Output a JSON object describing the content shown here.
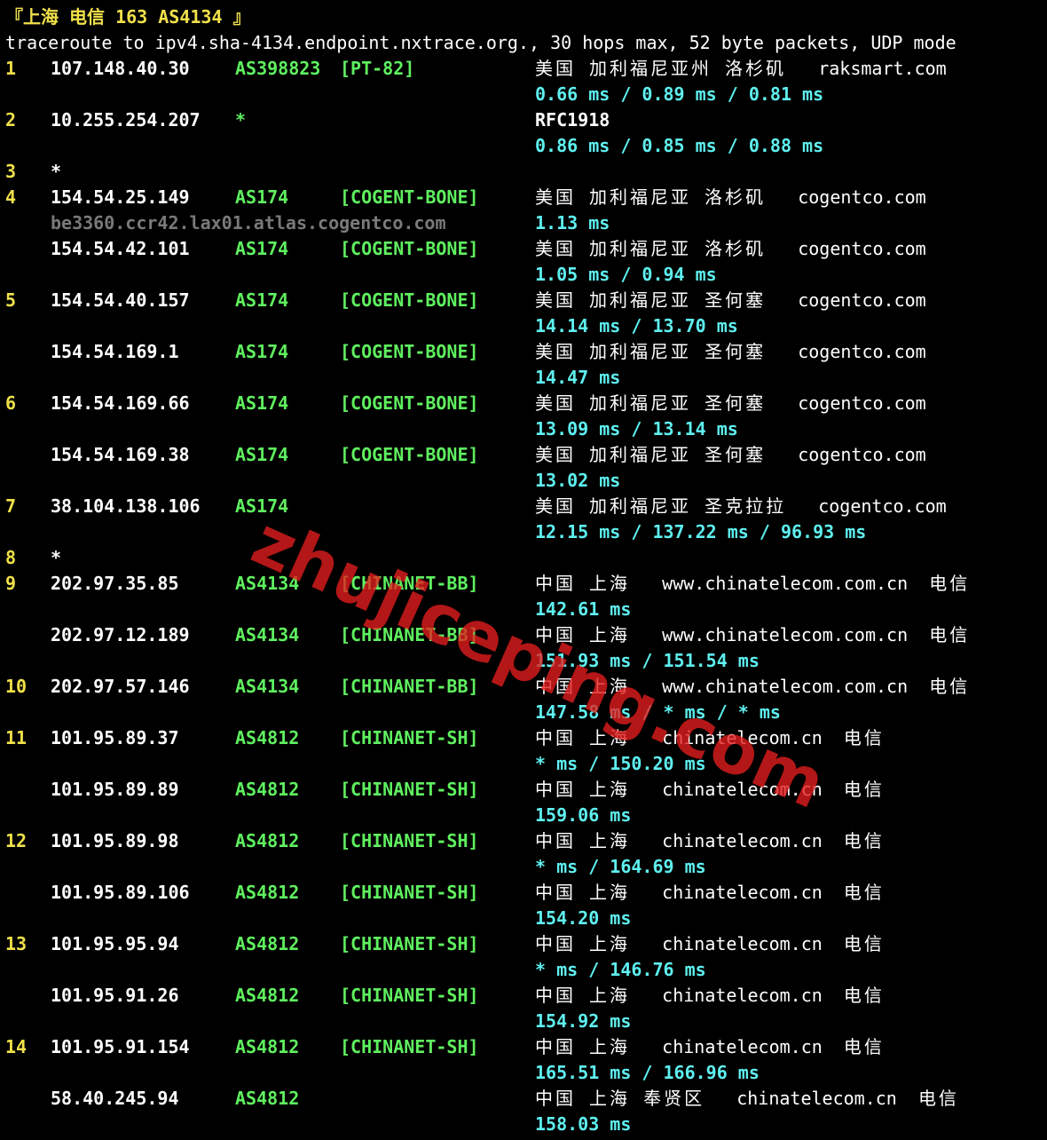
{
  "colors": {
    "background": "#000000",
    "hop_number": "#f0e14a",
    "asn": "#5ff05f",
    "latency": "#5ff0f0",
    "hostname": "#7a7a7a",
    "watermark": "#e61e1e"
  },
  "header": {
    "title": "『上海 电信 163 AS4134 』",
    "command": "traceroute to ipv4.sha-4134.endpoint.nxtrace.org., 30 hops max, 52 byte packets, UDP mode"
  },
  "watermark": "zhujiceping.com",
  "rows": [
    {
      "hop": "1",
      "ip": "107.148.40.30",
      "asn": "AS398823",
      "tag": "[PT-82]",
      "geo": "美国 加利福尼亚州 洛杉矶",
      "domain": "raksmart.com",
      "isp": ""
    },
    {
      "latency": "0.66 ms / 0.89 ms / 0.81 ms"
    },
    {
      "hop": "2",
      "ip": "10.255.254.207",
      "asn": "*",
      "tag": "",
      "geo": "RFC1918",
      "domain": "",
      "isp": ""
    },
    {
      "latency": "0.86 ms / 0.85 ms / 0.88 ms"
    },
    {
      "hop": "3",
      "ip": "*"
    },
    {
      "hop": "4",
      "ip": "154.54.25.149",
      "asn": "AS174",
      "tag": "[COGENT-BONE]",
      "geo": "美国 加利福尼亚 洛杉矶",
      "domain": "cogentco.com",
      "isp": ""
    },
    {
      "hostname": "be3360.ccr42.lax01.atlas.cogentco.com",
      "latency": "1.13 ms"
    },
    {
      "ip": "154.54.42.101",
      "asn": "AS174",
      "tag": "[COGENT-BONE]",
      "geo": "美国 加利福尼亚 洛杉矶",
      "domain": "cogentco.com",
      "isp": ""
    },
    {
      "latency": "1.05 ms / 0.94 ms"
    },
    {
      "hop": "5",
      "ip": "154.54.40.157",
      "asn": "AS174",
      "tag": "[COGENT-BONE]",
      "geo": "美国 加利福尼亚 圣何塞",
      "domain": "cogentco.com",
      "isp": ""
    },
    {
      "latency": "14.14 ms / 13.70 ms"
    },
    {
      "ip": "154.54.169.1",
      "asn": "AS174",
      "tag": "[COGENT-BONE]",
      "geo": "美国 加利福尼亚 圣何塞",
      "domain": "cogentco.com",
      "isp": ""
    },
    {
      "latency": "14.47 ms"
    },
    {
      "hop": "6",
      "ip": "154.54.169.66",
      "asn": "AS174",
      "tag": "[COGENT-BONE]",
      "geo": "美国 加利福尼亚 圣何塞",
      "domain": "cogentco.com",
      "isp": ""
    },
    {
      "latency": "13.09 ms / 13.14 ms"
    },
    {
      "ip": "154.54.169.38",
      "asn": "AS174",
      "tag": "[COGENT-BONE]",
      "geo": "美国 加利福尼亚 圣何塞",
      "domain": "cogentco.com",
      "isp": ""
    },
    {
      "latency": "13.02 ms"
    },
    {
      "hop": "7",
      "ip": "38.104.138.106",
      "asn": "AS174",
      "tag": "",
      "geo": "美国 加利福尼亚 圣克拉拉",
      "domain": "cogentco.com",
      "isp": ""
    },
    {
      "latency": "12.15 ms / 137.22 ms / 96.93 ms"
    },
    {
      "hop": "8",
      "ip": "*"
    },
    {
      "hop": "9",
      "ip": "202.97.35.85",
      "asn": "AS4134",
      "tag": "[CHINANET-BB]",
      "geo": "中国 上海",
      "domain": "www.chinatelecom.com.cn",
      "isp": "电信"
    },
    {
      "latency": "142.61 ms"
    },
    {
      "ip": "202.97.12.189",
      "asn": "AS4134",
      "tag": "[CHINANET-BB]",
      "geo": "中国 上海",
      "domain": "www.chinatelecom.com.cn",
      "isp": "电信"
    },
    {
      "latency": "151.93 ms / 151.54 ms"
    },
    {
      "hop": "10",
      "ip": "202.97.57.146",
      "asn": "AS4134",
      "tag": "[CHINANET-BB]",
      "geo": "中国 上海",
      "domain": "www.chinatelecom.com.cn",
      "isp": "电信"
    },
    {
      "latency": "147.58 ms / * ms / * ms"
    },
    {
      "hop": "11",
      "ip": "101.95.89.37",
      "asn": "AS4812",
      "tag": "[CHINANET-SH]",
      "geo": "中国 上海",
      "domain": "chinatelecom.cn",
      "isp": "电信"
    },
    {
      "latency": "* ms / 150.20 ms"
    },
    {
      "ip": "101.95.89.89",
      "asn": "AS4812",
      "tag": "[CHINANET-SH]",
      "geo": "中国 上海",
      "domain": "chinatelecom.cn",
      "isp": "电信"
    },
    {
      "latency": "159.06 ms"
    },
    {
      "hop": "12",
      "ip": "101.95.89.98",
      "asn": "AS4812",
      "tag": "[CHINANET-SH]",
      "geo": "中国 上海",
      "domain": "chinatelecom.cn",
      "isp": "电信"
    },
    {
      "latency": "* ms / 164.69 ms"
    },
    {
      "ip": "101.95.89.106",
      "asn": "AS4812",
      "tag": "[CHINANET-SH]",
      "geo": "中国 上海",
      "domain": "chinatelecom.cn",
      "isp": "电信"
    },
    {
      "latency": "154.20 ms"
    },
    {
      "hop": "13",
      "ip": "101.95.95.94",
      "asn": "AS4812",
      "tag": "[CHINANET-SH]",
      "geo": "中国 上海",
      "domain": "chinatelecom.cn",
      "isp": "电信"
    },
    {
      "latency": "* ms / 146.76 ms"
    },
    {
      "ip": "101.95.91.26",
      "asn": "AS4812",
      "tag": "[CHINANET-SH]",
      "geo": "中国 上海",
      "domain": "chinatelecom.cn",
      "isp": "电信"
    },
    {
      "latency": "154.92 ms"
    },
    {
      "hop": "14",
      "ip": "101.95.91.154",
      "asn": "AS4812",
      "tag": "[CHINANET-SH]",
      "geo": "中国 上海",
      "domain": "chinatelecom.cn",
      "isp": "电信"
    },
    {
      "latency": "165.51 ms / 166.96 ms"
    },
    {
      "ip": "58.40.245.94",
      "asn": "AS4812",
      "tag": "",
      "geo": "中国 上海 奉贤区",
      "domain": "chinatelecom.cn",
      "isp": "电信"
    },
    {
      "latency": "158.03 ms"
    }
  ]
}
